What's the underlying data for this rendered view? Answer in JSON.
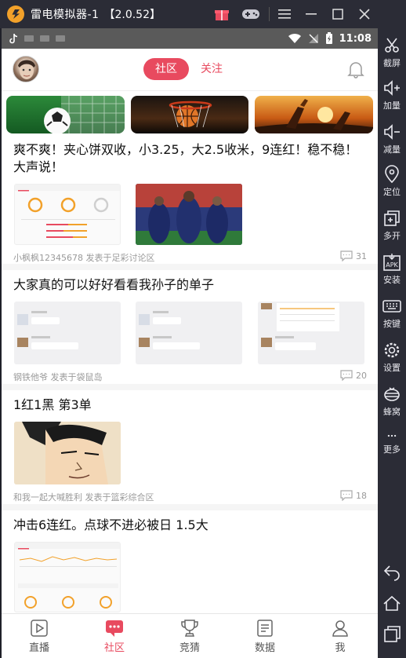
{
  "emulator": {
    "title": "雷电模拟器-1",
    "version": "【2.0.52】"
  },
  "sidebar": {
    "items": [
      {
        "label": "截屏",
        "icon": "scissors-icon"
      },
      {
        "label": "加量",
        "icon": "volume-up-icon"
      },
      {
        "label": "减量",
        "icon": "volume-down-icon"
      },
      {
        "label": "定位",
        "icon": "location-icon"
      },
      {
        "label": "多开",
        "icon": "multi-instance-icon"
      },
      {
        "label": "安装",
        "icon": "apk-install-icon"
      },
      {
        "label": "按键",
        "icon": "keyboard-icon"
      },
      {
        "label": "设置",
        "icon": "gear-icon"
      },
      {
        "label": "蜂窝",
        "icon": "hive-icon"
      },
      {
        "label": "更多",
        "icon": "more-icon"
      }
    ]
  },
  "statusbar": {
    "time": "11:08"
  },
  "header": {
    "tab_active": "社区",
    "tab_other": "关注"
  },
  "posts": [
    {
      "title": "爽不爽！夹心饼双收，小3.25，大2.5收米，9连红！稳不稳！大声说！",
      "meta": "小枫枫12345678 发表于足彩讨论区",
      "comments": "31"
    },
    {
      "title": "大家真的可以好好看看我孙子的单子",
      "meta": "钢铁他爷 发表于袋鼠岛",
      "comments": "20"
    },
    {
      "title": "1红1黑 第3单",
      "meta": "和我一起大喊胜利 发表于篮彩综合区",
      "comments": "18"
    },
    {
      "title": "冲击6连红。点球不进必被日 1.5大"
    }
  ],
  "bottom_nav": [
    {
      "label": "直播",
      "icon": "live-play-icon"
    },
    {
      "label": "社区",
      "icon": "community-icon"
    },
    {
      "label": "竞猜",
      "icon": "trophy-icon"
    },
    {
      "label": "数据",
      "icon": "data-icon"
    },
    {
      "label": "我",
      "icon": "person-icon"
    }
  ],
  "colors": {
    "accent": "#e84a5f",
    "chrome": "#2b2c36"
  }
}
